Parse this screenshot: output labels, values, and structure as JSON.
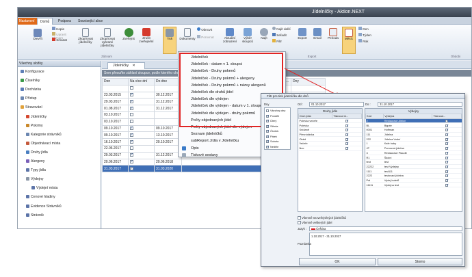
{
  "window": {
    "title": "Jídelníčky - Aktion.NEXT"
  },
  "ribbon_tabs": [
    "Nastavení",
    "Domů",
    "Podpora",
    "Související akce"
  ],
  "ribbon": {
    "buttons": [
      {
        "label": "Otevřít",
        "icon": "open-icon"
      },
      {
        "label": "Kopie",
        "icon": "copy-icon"
      },
      {
        "label": "Upravit záznam",
        "icon": "edit-icon"
      },
      {
        "label": "Smazat",
        "icon": "delete-icon"
      },
      {
        "label": "Zkopírovat jídelníčky",
        "icon": "copy-menu-icon"
      },
      {
        "label": "Zkopírovat vybrané jídelníčky",
        "icon": "copy-selected-icon"
      },
      {
        "label": "Zveřejnit",
        "icon": "publish-icon"
      },
      {
        "label": "Zrušit zveřejnění",
        "icon": "unpublish-icon"
      },
      {
        "label": "Tisk",
        "icon": "print-icon"
      },
      {
        "label": "Dokumenty",
        "icon": "documents-icon"
      },
      {
        "label": "Obnovit",
        "icon": "refresh-icon"
      },
      {
        "label": "Porovnat",
        "icon": "compare-icon"
      },
      {
        "label": "Aktuální zobrazení",
        "icon": "view-icon"
      },
      {
        "label": "Výběr sloupců",
        "icon": "columns-icon"
      },
      {
        "label": "Najít",
        "icon": "find-icon"
      },
      {
        "label": "Najít další",
        "icon": "find-next-icon"
      },
      {
        "label": "Seřadit",
        "icon": "sort-icon"
      },
      {
        "label": "Filtr",
        "icon": "filter-icon"
      },
      {
        "label": "Export",
        "icon": "export-icon"
      },
      {
        "label": "Email",
        "icon": "email-icon"
      },
      {
        "label": "Perioda",
        "icon": "period-icon"
      },
      {
        "label": "Měsíc",
        "icon": "month-icon"
      },
      {
        "label": "Den",
        "icon": "day-icon"
      },
      {
        "label": "Týden",
        "icon": "week-icon"
      },
      {
        "label": "Rok",
        "icon": "year-icon"
      }
    ],
    "groups": [
      "Záznam",
      "Nástroje",
      "Export",
      "Obdobi"
    ]
  },
  "sidebar": {
    "header": "Všechny složky",
    "items": [
      "Konfigurace",
      "Číselníky",
      "Docházka",
      "Přístup",
      "Stravování",
      "Jídelníčky",
      "Pokrmy",
      "Kategorie strávníků",
      "Objednávací místa",
      "Druhy jídla",
      "Alergeny",
      "Typy jídla",
      "Výdejny",
      "Výdejní místa",
      "Cenové hladiny",
      "Evidence Strávníků",
      "Strávník"
    ]
  },
  "main": {
    "tab": "Jídelníčky",
    "group_hint": "Sem přesuňte záhlaví sloupce, podle kterého chcete seskupovat",
    "columns": [
      "Den",
      "Na více dní",
      "Do dne",
      "",
      "Jídelní kalen...",
      "Dny"
    ],
    "rows": [
      {
        "den": "23.03.2015",
        "multi": true,
        "do": "30.12.2017"
      },
      {
        "den": "29.03.2017",
        "multi": true,
        "do": "31.12.2017"
      },
      {
        "den": "01.08.2017",
        "multi": true,
        "do": "31.12.2017"
      },
      {
        "den": "03.10.2017",
        "multi": false,
        "do": ""
      },
      {
        "den": "03.10.2017",
        "multi": false,
        "do": ""
      },
      {
        "den": "09.10.2017",
        "multi": true,
        "do": "09.10.2017"
      },
      {
        "den": "09.10.2017",
        "multi": true,
        "do": "13.10.2017"
      },
      {
        "den": "16.10.2017",
        "multi": true,
        "do": "20.10.2017"
      },
      {
        "den": "22.06.2017",
        "multi": false,
        "do": ""
      },
      {
        "den": "29.03.2017",
        "multi": true,
        "do": "31.12.2017"
      },
      {
        "den": "20.06.2017",
        "multi": true,
        "do": "20.06.2018"
      },
      {
        "den": "31.03.2017",
        "multi": true,
        "do": "31.03.2020"
      }
    ]
  },
  "print_menu": {
    "items": [
      "Jídelníček",
      "Jídelníček - datum v 1. sloupci",
      "Jídelníček - Druhy pokrmů",
      "Jídelníček - Druhy pokrmů + alergeny",
      "Jídelníček - Druhy pokrmů + názvy alergenů",
      "Jídelníček dle druhů jídel",
      "Jídelníček dle výdejen",
      "Jídelníček dle výdejen - datum v 1. sloupci",
      "Jídelníček dle výdejen - druhy pokrmů",
      "Počty objednaných jídel",
      "Počty objednaných jídel dle výdejen",
      "Seznam jídelníčků",
      "subReport Jídla v Jídelníčku",
      "Opis",
      "Tiskové sestavy"
    ]
  },
  "dialog": {
    "title": "Filtr pro tisk jídelníčku dle dnů",
    "dny_label": "Dny",
    "od_label": "Od :",
    "od_value": "01.10.2017",
    "do_label": "Do :",
    "do_value": "31.10.2017",
    "days": [
      "Všechny dny",
      "Pondělí",
      "Úterý",
      "Středa",
      "Čtvrtek",
      "Pátek",
      "Sobota",
      "Neděle"
    ],
    "druhy_title": "Druhy jídla",
    "druhy_headers": [
      "Druh jídla",
      "Tisknout sl..."
    ],
    "druhy": [
      "Polévka večeře",
      "Polévka",
      "Snídaně",
      "Přesnídávka",
      "Oběd",
      "Večeře",
      "Noc"
    ],
    "vydejny_title": "Výdejny",
    "vydejny_headers": [
      "Kód",
      "Výdejna",
      "Tisknout..."
    ],
    "vydejny": [
      {
        "kod": "2",
        "nazev": "Restaurace Albion"
      },
      {
        "kod": "BL",
        "nazev": "Bigote"
      },
      {
        "kod": "0001",
        "nazev": "Hoffman"
      },
      {
        "kod": "111",
        "nazev": "Jídelna"
      },
      {
        "kod": "222",
        "nazev": "Jídelna Vodní"
      },
      {
        "kod": "1",
        "nazev": "Kafe baby"
      },
      {
        "kod": "JP",
        "nazev": "Pomocná jídelna"
      },
      {
        "kod": "3",
        "nazev": "Restaurace Plaudit"
      },
      {
        "kod": "R1",
        "nazev": "Školní"
      },
      {
        "kod": "test",
        "nazev": "test"
      },
      {
        "kod": "22222",
        "nazev": "test Výdejny"
      },
      {
        "kod": "1111",
        "nazev": "test111"
      },
      {
        "kod": "2222",
        "nazev": "testovací jídelna"
      },
      {
        "kod": "Pal",
        "nazev": "Výdej bufetů"
      },
      {
        "kod": "11111",
        "nazev": "Výdejna test"
      }
    ],
    "opt1": "Všemně nezveřejněných jídelníčků",
    "opt2": "Všemně veškerých jídel",
    "jazyk_label": "Jazyk :",
    "jazyk_value": "Čeština",
    "poznamka_label": "Poznámka",
    "poznamka_value": "1.10.2017 - 31.10.2017",
    "ok": "OK",
    "cancel": "Storno"
  }
}
